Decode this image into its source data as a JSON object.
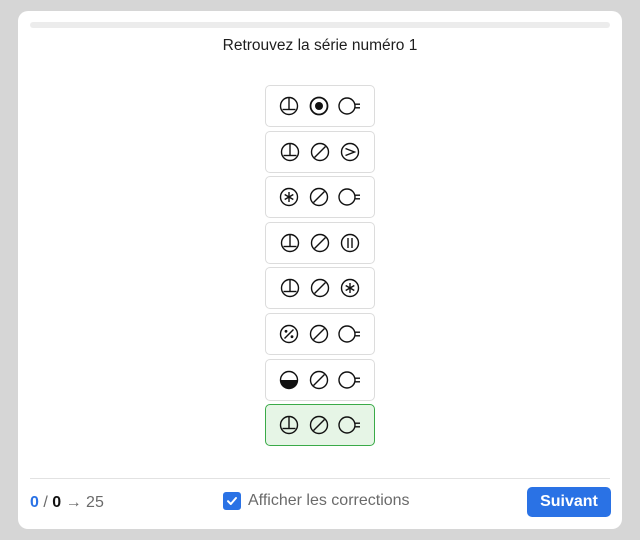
{
  "progress": {
    "fraction": 0
  },
  "title": "Retrouvez la série numéro 1",
  "options": [
    {
      "symbols": [
        "earth-symbol",
        "dot-circle-symbol",
        "plug-symbol"
      ],
      "state": "default"
    },
    {
      "symbols": [
        "earth-symbol",
        "slash-circle-symbol",
        "arrow-circle-symbol"
      ],
      "state": "default"
    },
    {
      "symbols": [
        "asterisk-circle-symbol",
        "slash-circle-symbol",
        "plug-symbol"
      ],
      "state": "default"
    },
    {
      "symbols": [
        "earth-symbol",
        "slash-circle-symbol",
        "bars-circle-symbol"
      ],
      "state": "default"
    },
    {
      "symbols": [
        "earth-symbol",
        "slash-circle-symbol",
        "asterisk-circle-symbol"
      ],
      "state": "default"
    },
    {
      "symbols": [
        "percent-circle-symbol",
        "slash-circle-symbol",
        "plug-symbol"
      ],
      "state": "default"
    },
    {
      "symbols": [
        "half-filled-circle-symbol",
        "slash-circle-symbol",
        "plug-symbol"
      ],
      "state": "default"
    },
    {
      "symbols": [
        "earth-symbol",
        "slash-circle-symbol",
        "plug-symbol"
      ],
      "state": "correct"
    }
  ],
  "footer": {
    "score_done": "0",
    "score_sep": " / ",
    "score_errors": "0",
    "score_arrow": " → ",
    "score_total": "25",
    "corrections_checked": true,
    "corrections_label": "Afficher les corrections",
    "next_label": "Suivant"
  },
  "colors": {
    "accent": "#2a72e5",
    "correct_bg": "#e6f5e6",
    "correct_border": "#3aaa48"
  }
}
